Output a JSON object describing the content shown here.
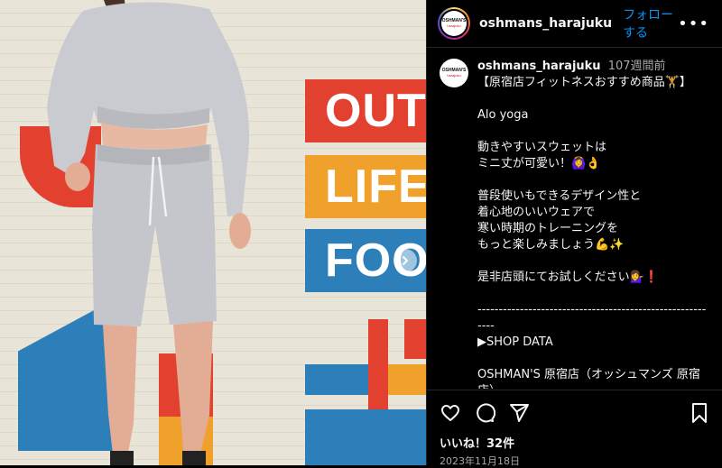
{
  "header": {
    "username": "oshmans_harajuku",
    "follow_label": "フォローする",
    "more_label": "•••",
    "avatar_logo_top": "OSHMAN'S",
    "avatar_logo_bottom": "harajuku"
  },
  "photo": {
    "sign_texts": [
      "OUT",
      "LIFE",
      "FOO"
    ],
    "colors": {
      "red": "#e2412f",
      "orange": "#f0a12c",
      "blue": "#2c7fb8",
      "wall": "#e9e4d8",
      "sweat": "#c9cbd0"
    }
  },
  "caption": {
    "username": "oshmans_harajuku",
    "time": "107週間前",
    "text": "【原宿店フィットネスおすすめ商品🏋️】\n\nAlo yoga\n\n動きやすいスウェットは\nミニ丈が可愛い！🙆‍♀️👌\n\n普段使いもできるデザイン性と\n着心地のいいウェアで\n寒い時期のトレーニングを\nもっと楽しみましょう💪✨\n\n是非店頭にてお試しください💁‍♀️❗\n\n----------------------------------------------------------\n▶SHOP DATA\n\nOSHMAN'S 原宿店（オッシュマンズ 原宿店）"
  },
  "footer": {
    "likes": "いいね！32件",
    "date": "2023年11月18日"
  },
  "icons": {
    "like": "heart-icon",
    "comment": "comment-icon",
    "share": "send-icon",
    "save": "bookmark-icon",
    "next": "chevron-right-icon"
  }
}
